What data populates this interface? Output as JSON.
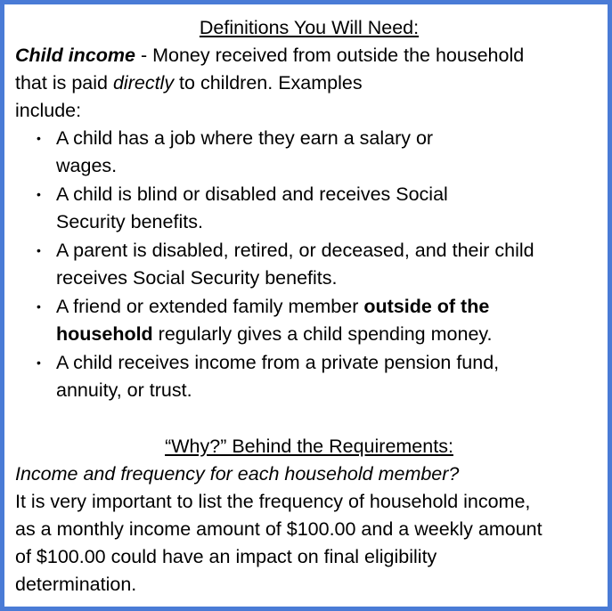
{
  "definitions": {
    "heading": "Definitions You Will Need:",
    "term": "Child income",
    "intro_rest_1": " - Money received from outside the household",
    "intro_line2_a": "that is paid ",
    "intro_line2_italic": "directly",
    "intro_line2_b": " to children. Examples",
    "intro_line3": "include:",
    "bullet_glyph": "•",
    "bullets": [
      {
        "l1": "A child has a job where they earn a salary or",
        "l2": "wages."
      },
      {
        "l1": "A child is blind or disabled and receives Social",
        "l2": "Security benefits."
      },
      {
        "l1": "A parent is disabled, retired, or deceased, and their child",
        "l2": "receives Social Security benefits."
      },
      {
        "l1_a": "A friend or extended family member ",
        "l1_bold": "outside of the",
        "l2_bold": "household",
        "l2_b": " regularly gives a child spending money."
      },
      {
        "l1": "A child receives income from a private pension fund,",
        "l2": "annuity, or trust."
      }
    ]
  },
  "why": {
    "heading": "“Why?” Behind the Requirements:",
    "question": "Income and frequency for each household member?",
    "lines": [
      "It is very important to list the frequency of household income,",
      "as a monthly income amount of $100.00 and a weekly amount",
      "of $100.00 could have an impact on final eligibility",
      "determination."
    ]
  },
  "colors": {
    "border": "#4a7bd6",
    "text": "#000000",
    "background": "#ffffff"
  }
}
